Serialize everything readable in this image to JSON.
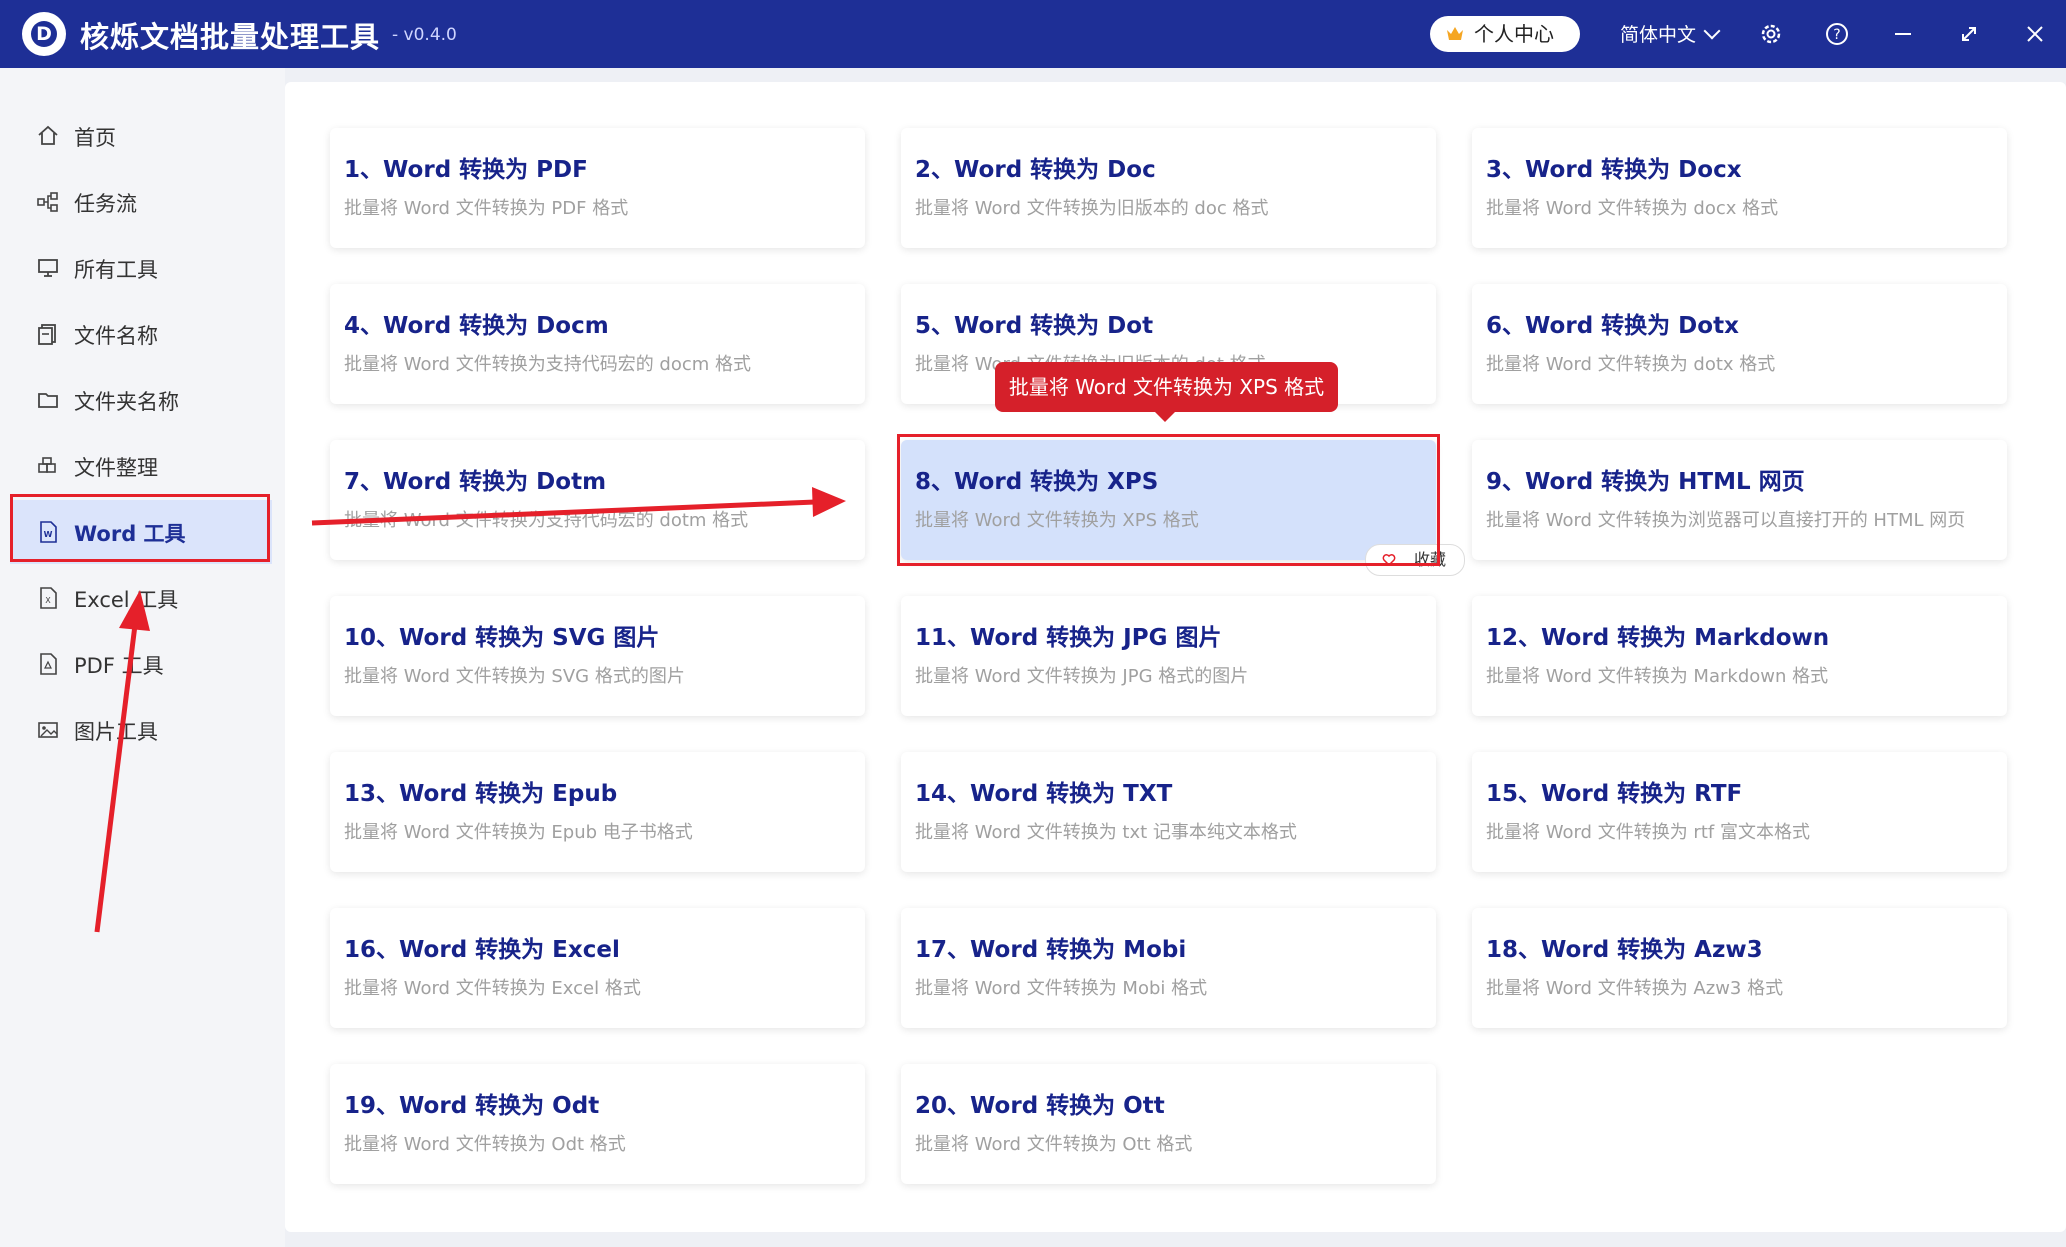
{
  "app": {
    "title": "核烁文档批量处理工具",
    "version": "- v0.4.0",
    "logo_letter": "D",
    "user_center": "个人中心",
    "language": "简体中文",
    "icons": [
      "settings-icon",
      "help-icon",
      "minimize-icon",
      "maximize-icon",
      "close-icon"
    ]
  },
  "sidebar": {
    "items": [
      {
        "label": "首页",
        "icon": "home-icon"
      },
      {
        "label": "任务流",
        "icon": "workflow-icon"
      },
      {
        "label": "所有工具",
        "icon": "monitor-icon"
      },
      {
        "label": "文件名称",
        "icon": "file-name-icon"
      },
      {
        "label": "文件夹名称",
        "icon": "folder-icon"
      },
      {
        "label": "文件整理",
        "icon": "organize-icon"
      },
      {
        "label": "Word 工具",
        "icon": "word-file-icon",
        "active": true
      },
      {
        "label": "Excel 工具",
        "icon": "excel-file-icon"
      },
      {
        "label": "PDF 工具",
        "icon": "pdf-file-icon"
      },
      {
        "label": "图片工具",
        "icon": "image-icon"
      }
    ]
  },
  "tools": [
    {
      "title": "1、Word 转换为 PDF",
      "desc": "批量将 Word 文件转换为 PDF 格式"
    },
    {
      "title": "2、Word 转换为 Doc",
      "desc": "批量将 Word 文件转换为旧版本的 doc 格式"
    },
    {
      "title": "3、Word 转换为 Docx",
      "desc": "批量将 Word 文件转换为 docx 格式"
    },
    {
      "title": "4、Word 转换为 Docm",
      "desc": "批量将 Word 文件转换为支持代码宏的 docm 格式"
    },
    {
      "title": "5、Word 转换为 Dot",
      "desc": "批量将 Word 文件转换为旧版本的 dot 格式"
    },
    {
      "title": "6、Word 转换为 Dotx",
      "desc": "批量将 Word 文件转换为 dotx 格式"
    },
    {
      "title": "7、Word 转换为 Dotm",
      "desc": "批量将 Word 文件转换为支持代码宏的 dotm 格式"
    },
    {
      "title": "8、Word 转换为 XPS",
      "desc": "批量将 Word 文件转换为 XPS 格式",
      "selected": true
    },
    {
      "title": "9、Word 转换为 HTML 网页",
      "desc": "批量将 Word 文件转换为浏览器可以直接打开的 HTML 网页"
    },
    {
      "title": "10、Word 转换为 SVG 图片",
      "desc": "批量将 Word 文件转换为 SVG 格式的图片"
    },
    {
      "title": "11、Word 转换为 JPG 图片",
      "desc": "批量将 Word 文件转换为 JPG 格式的图片"
    },
    {
      "title": "12、Word 转换为 Markdown",
      "desc": "批量将 Word 文件转换为 Markdown 格式"
    },
    {
      "title": "13、Word 转换为 Epub",
      "desc": "批量将 Word 文件转换为 Epub 电子书格式"
    },
    {
      "title": "14、Word 转换为 TXT",
      "desc": "批量将 Word 文件转换为 txt 记事本纯文本格式"
    },
    {
      "title": "15、Word 转换为 RTF",
      "desc": "批量将 Word 文件转换为 rtf 富文本格式"
    },
    {
      "title": "16、Word 转换为 Excel",
      "desc": "批量将 Word 文件转换为 Excel 格式"
    },
    {
      "title": "17、Word 转换为 Mobi",
      "desc": "批量将 Word 文件转换为 Mobi 格式"
    },
    {
      "title": "18、Word 转换为 Azw3",
      "desc": "批量将 Word 文件转换为 Azw3 格式"
    },
    {
      "title": "19、Word 转换为 Odt",
      "desc": "批量将 Word 文件转换为 Odt 格式"
    },
    {
      "title": "20、Word 转换为 Ott",
      "desc": "批量将 Word 文件转换为 Ott 格式"
    }
  ],
  "tooltip": "批量将 Word 文件转换为 XPS 格式",
  "favorite_label": "收藏",
  "colors": {
    "titlebar": "#1e2f96",
    "card_title": "#17238a",
    "highlight": "#e5202a",
    "selected_card": "#d4e1fb"
  }
}
